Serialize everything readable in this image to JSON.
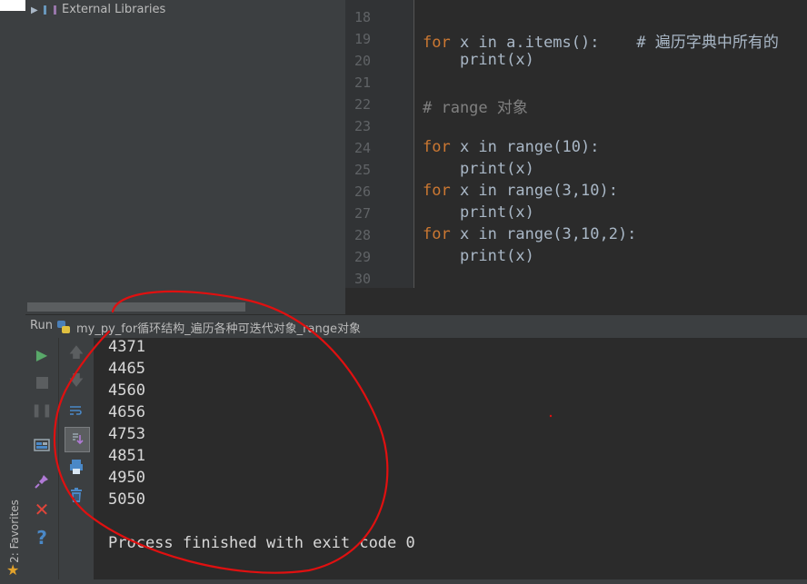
{
  "project": {
    "item_label": "External Libraries"
  },
  "editor": {
    "line_numbers": [
      "18",
      "19",
      "20",
      "21",
      "22",
      "23",
      "24",
      "25",
      "26",
      "27",
      "28",
      "29",
      "30"
    ],
    "lines": [
      {
        "kw": "",
        "rest": ""
      },
      {
        "kw": "for",
        "rest": " x in a.items():    # 遍历字典中所有的"
      },
      {
        "kw": "",
        "rest": "    print(x)"
      },
      {
        "kw": "",
        "rest": ""
      },
      {
        "kw": "",
        "rest": "# range 对象"
      },
      {
        "kw": "",
        "rest": ""
      },
      {
        "kw": "for",
        "rest": " x in range(10):"
      },
      {
        "kw": "",
        "rest": "    print(x)"
      },
      {
        "kw": "for",
        "rest": " x in range(3,10):"
      },
      {
        "kw": "",
        "rest": "    print(x)"
      },
      {
        "kw": "for",
        "rest": " x in range(3,10,2):"
      },
      {
        "kw": "",
        "rest": "    print(x)"
      },
      {
        "kw": "",
        "rest": ""
      }
    ]
  },
  "run": {
    "label": "Run",
    "config_name": "my_py_for循环结构_遍历各种可迭代对象_range对象"
  },
  "console": {
    "output": [
      "4371",
      "4465",
      "4560",
      "4656",
      "4753",
      "4851",
      "4950",
      "5050"
    ],
    "finish_message": "Process finished with exit code 0"
  },
  "sidebar": {
    "favorites_label": "2: Favorites"
  },
  "colors": {
    "keyword": "#cc7832",
    "builtin": "#8888c6",
    "number": "#6897bb",
    "comment": "#808080",
    "run_green": "#499c54",
    "annotation_red": "#e01010"
  }
}
